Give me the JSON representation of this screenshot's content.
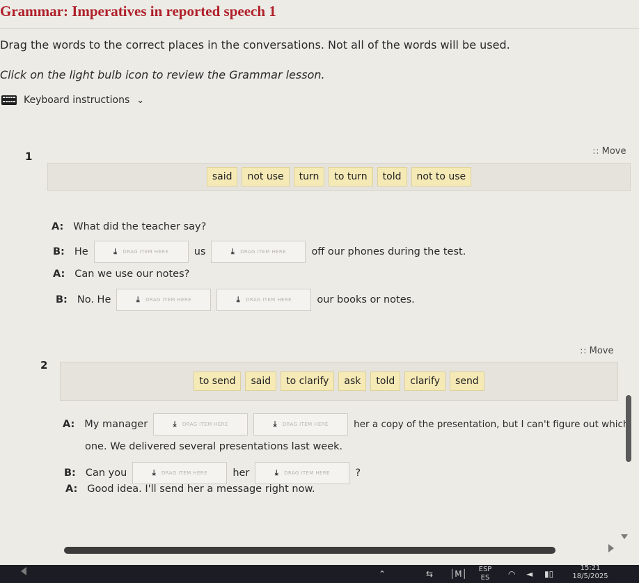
{
  "header": {
    "title": "Grammar: Imperatives in reported speech 1",
    "instruction": "Drag the words to the correct places in the conversations. Not all of the words will be used.",
    "instruction2": "Click on the light bulb icon to review the Grammar lesson.",
    "keyboard_label": "Keyboard instructions"
  },
  "question1": {
    "number": "1",
    "move_label": "Move",
    "chips": [
      "said",
      "not use",
      "turn",
      "to turn",
      "told",
      "not to use"
    ],
    "drop_placeholder": "DRAG ITEM HERE",
    "lines": [
      {
        "speaker": "A:",
        "text": "What did the teacher say?"
      },
      {
        "speaker": "B:",
        "pre": "He",
        "mid": "us",
        "post": "off our phones during the test."
      },
      {
        "speaker": "A:",
        "text": "Can we use our notes?"
      },
      {
        "speaker": "B:",
        "pre": "No. He",
        "post": "our books or notes."
      }
    ]
  },
  "question2": {
    "number": "2",
    "move_label": "Move",
    "chips": [
      "to send",
      "said",
      "to clarify",
      "ask",
      "told",
      "clarify",
      "send"
    ],
    "drop_placeholder": "DRAG ITEM HERE",
    "lines": [
      {
        "speaker": "A:",
        "pre": "My manager",
        "post": "her a copy of the presentation, but I can't figure out which",
        "cont": "one. We delivered several presentations last week."
      },
      {
        "speaker": "B:",
        "pre": "Can you",
        "mid": "her",
        "post": "?"
      },
      {
        "speaker": "A:",
        "text": "Good idea. I'll send her a message right now."
      }
    ]
  },
  "taskbar": {
    "lang_top": "ESP",
    "lang_bottom": "ES",
    "time": "15:21",
    "date": "18/5/2025"
  },
  "colors": {
    "title": "#b0202a",
    "chip_bg": "#f5e9b6",
    "bank_bg": "#e5e3dc",
    "page_bg": "#ecebe6"
  }
}
